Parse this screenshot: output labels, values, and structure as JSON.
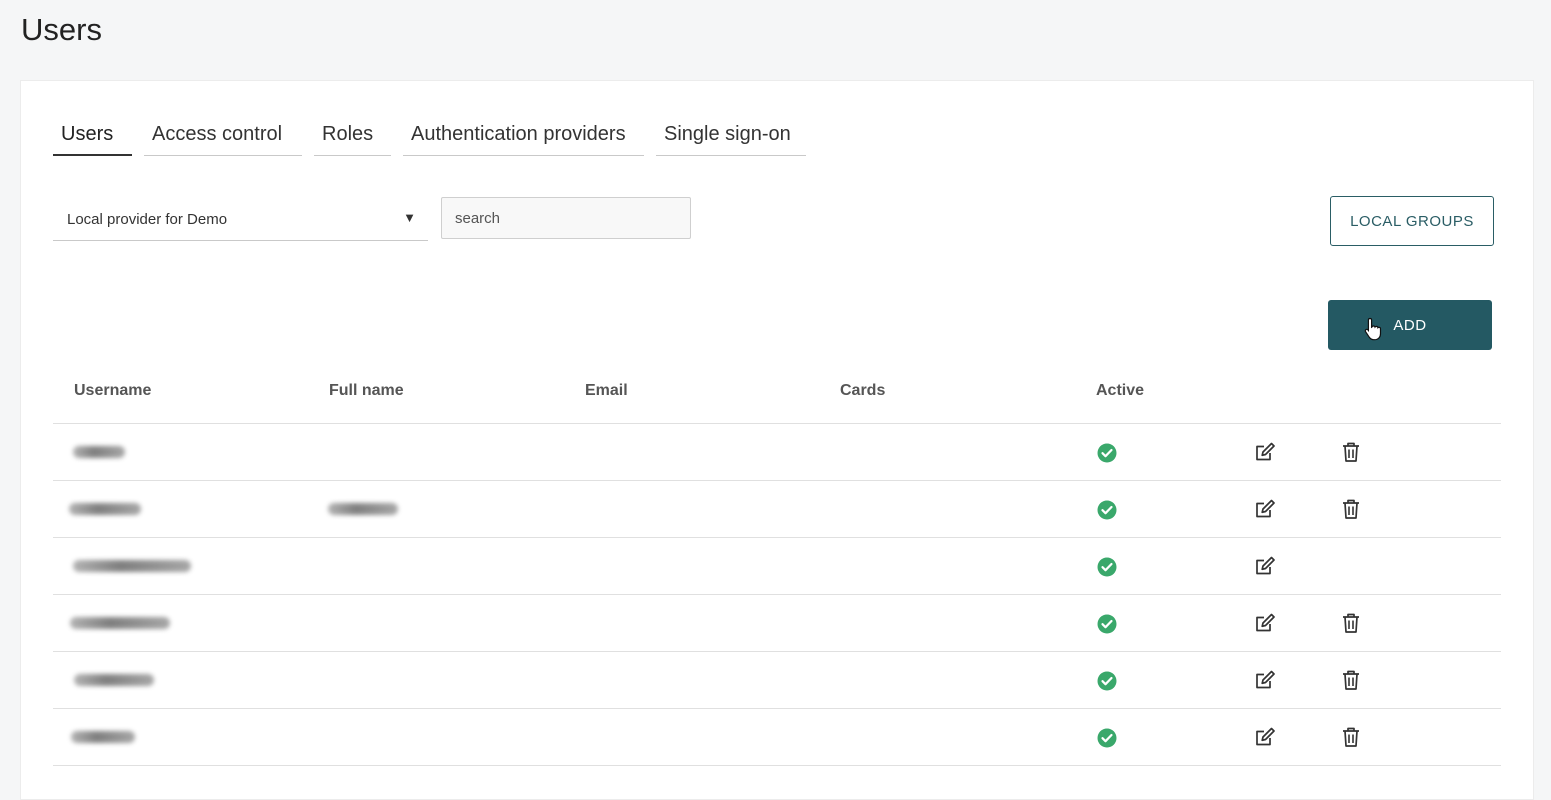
{
  "page": {
    "title": "Users"
  },
  "tabs": [
    {
      "label": "Users",
      "active": true
    },
    {
      "label": "Access control",
      "active": false
    },
    {
      "label": "Roles",
      "active": false
    },
    {
      "label": "Authentication providers",
      "active": false
    },
    {
      "label": "Single sign-on",
      "active": false
    }
  ],
  "filters": {
    "provider": {
      "selected": "Local provider for Demo",
      "icon": "caret-down-icon"
    },
    "search": {
      "placeholder": "search",
      "value": ""
    }
  },
  "buttons": {
    "local_groups": "LOCAL GROUPS",
    "add": "ADD"
  },
  "table": {
    "columns": [
      "Username",
      "Full name",
      "Email",
      "Cards",
      "Active"
    ],
    "rows": [
      {
        "username": "(blurred)",
        "full_name": "",
        "active": true,
        "editable": true,
        "deletable": true
      },
      {
        "username": "(blurred)",
        "full_name": "(blurred)",
        "active": true,
        "editable": true,
        "deletable": true
      },
      {
        "username": "(blurred)",
        "full_name": "",
        "active": true,
        "editable": true,
        "deletable": false
      },
      {
        "username": "(blurred)",
        "full_name": "",
        "active": true,
        "editable": true,
        "deletable": true
      },
      {
        "username": "(blurred)",
        "full_name": "",
        "active": true,
        "editable": true,
        "deletable": true
      },
      {
        "username": "(blurred)",
        "full_name": "",
        "active": true,
        "editable": true,
        "deletable": true
      }
    ]
  },
  "colors": {
    "accent": "#245963",
    "active_check": "#3aa86b"
  },
  "icons": {
    "active": "check-circle-icon",
    "edit": "edit-icon",
    "delete": "trash-icon",
    "cursor": "hand-cursor-icon"
  }
}
